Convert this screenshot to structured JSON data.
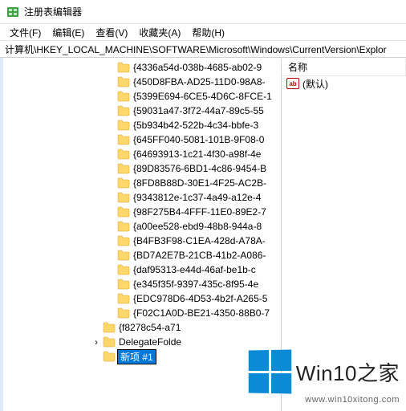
{
  "window": {
    "title": "注册表编辑器"
  },
  "menu": {
    "file": "文件(F)",
    "edit": "编辑(E)",
    "view": "查看(V)",
    "favorites": "收藏夹(A)",
    "help": "帮助(H)"
  },
  "address": "计算机\\HKEY_LOCAL_MACHINE\\SOFTWARE\\Microsoft\\Windows\\CurrentVersion\\Explor",
  "tree": {
    "items": [
      "{4336a54d-038b-4685-ab02-9",
      "{450D8FBA-AD25-11D0-98A8-",
      "{5399E694-6CE5-4D6C-8FCE-1",
      "{59031a47-3f72-44a7-89c5-55",
      "{5b934b42-522b-4c34-bbfe-3",
      "{645FF040-5081-101B-9F08-0",
      "{64693913-1c21-4f30-a98f-4e",
      "{89D83576-6BD1-4c86-9454-B",
      "{8FD8B88D-30E1-4F25-AC2B-",
      "{9343812e-1c37-4a49-a12e-4",
      "{98F275B4-4FFF-11E0-89E2-7",
      "{a00ee528-ebd9-48b8-944a-8",
      "{B4FB3F98-C1EA-428d-A78A-",
      "{BD7A2E7B-21CB-41b2-A086-",
      "{daf95313-e44d-46af-be1b-c",
      "{e345f35f-9397-435c-8f95-4e",
      "{EDC978D6-4D53-4b2f-A265-5",
      "{F02C1A0D-BE21-4350-88B0-7",
      "{f8278c54-a71",
      "DelegateFolde"
    ],
    "new_item": "新项 #1",
    "new_item_expanded": true
  },
  "list": {
    "header_name": "名称",
    "default_value": "(默认)"
  },
  "watermark": {
    "text": "Win10之家",
    "url": "www.win10xitong.com"
  }
}
